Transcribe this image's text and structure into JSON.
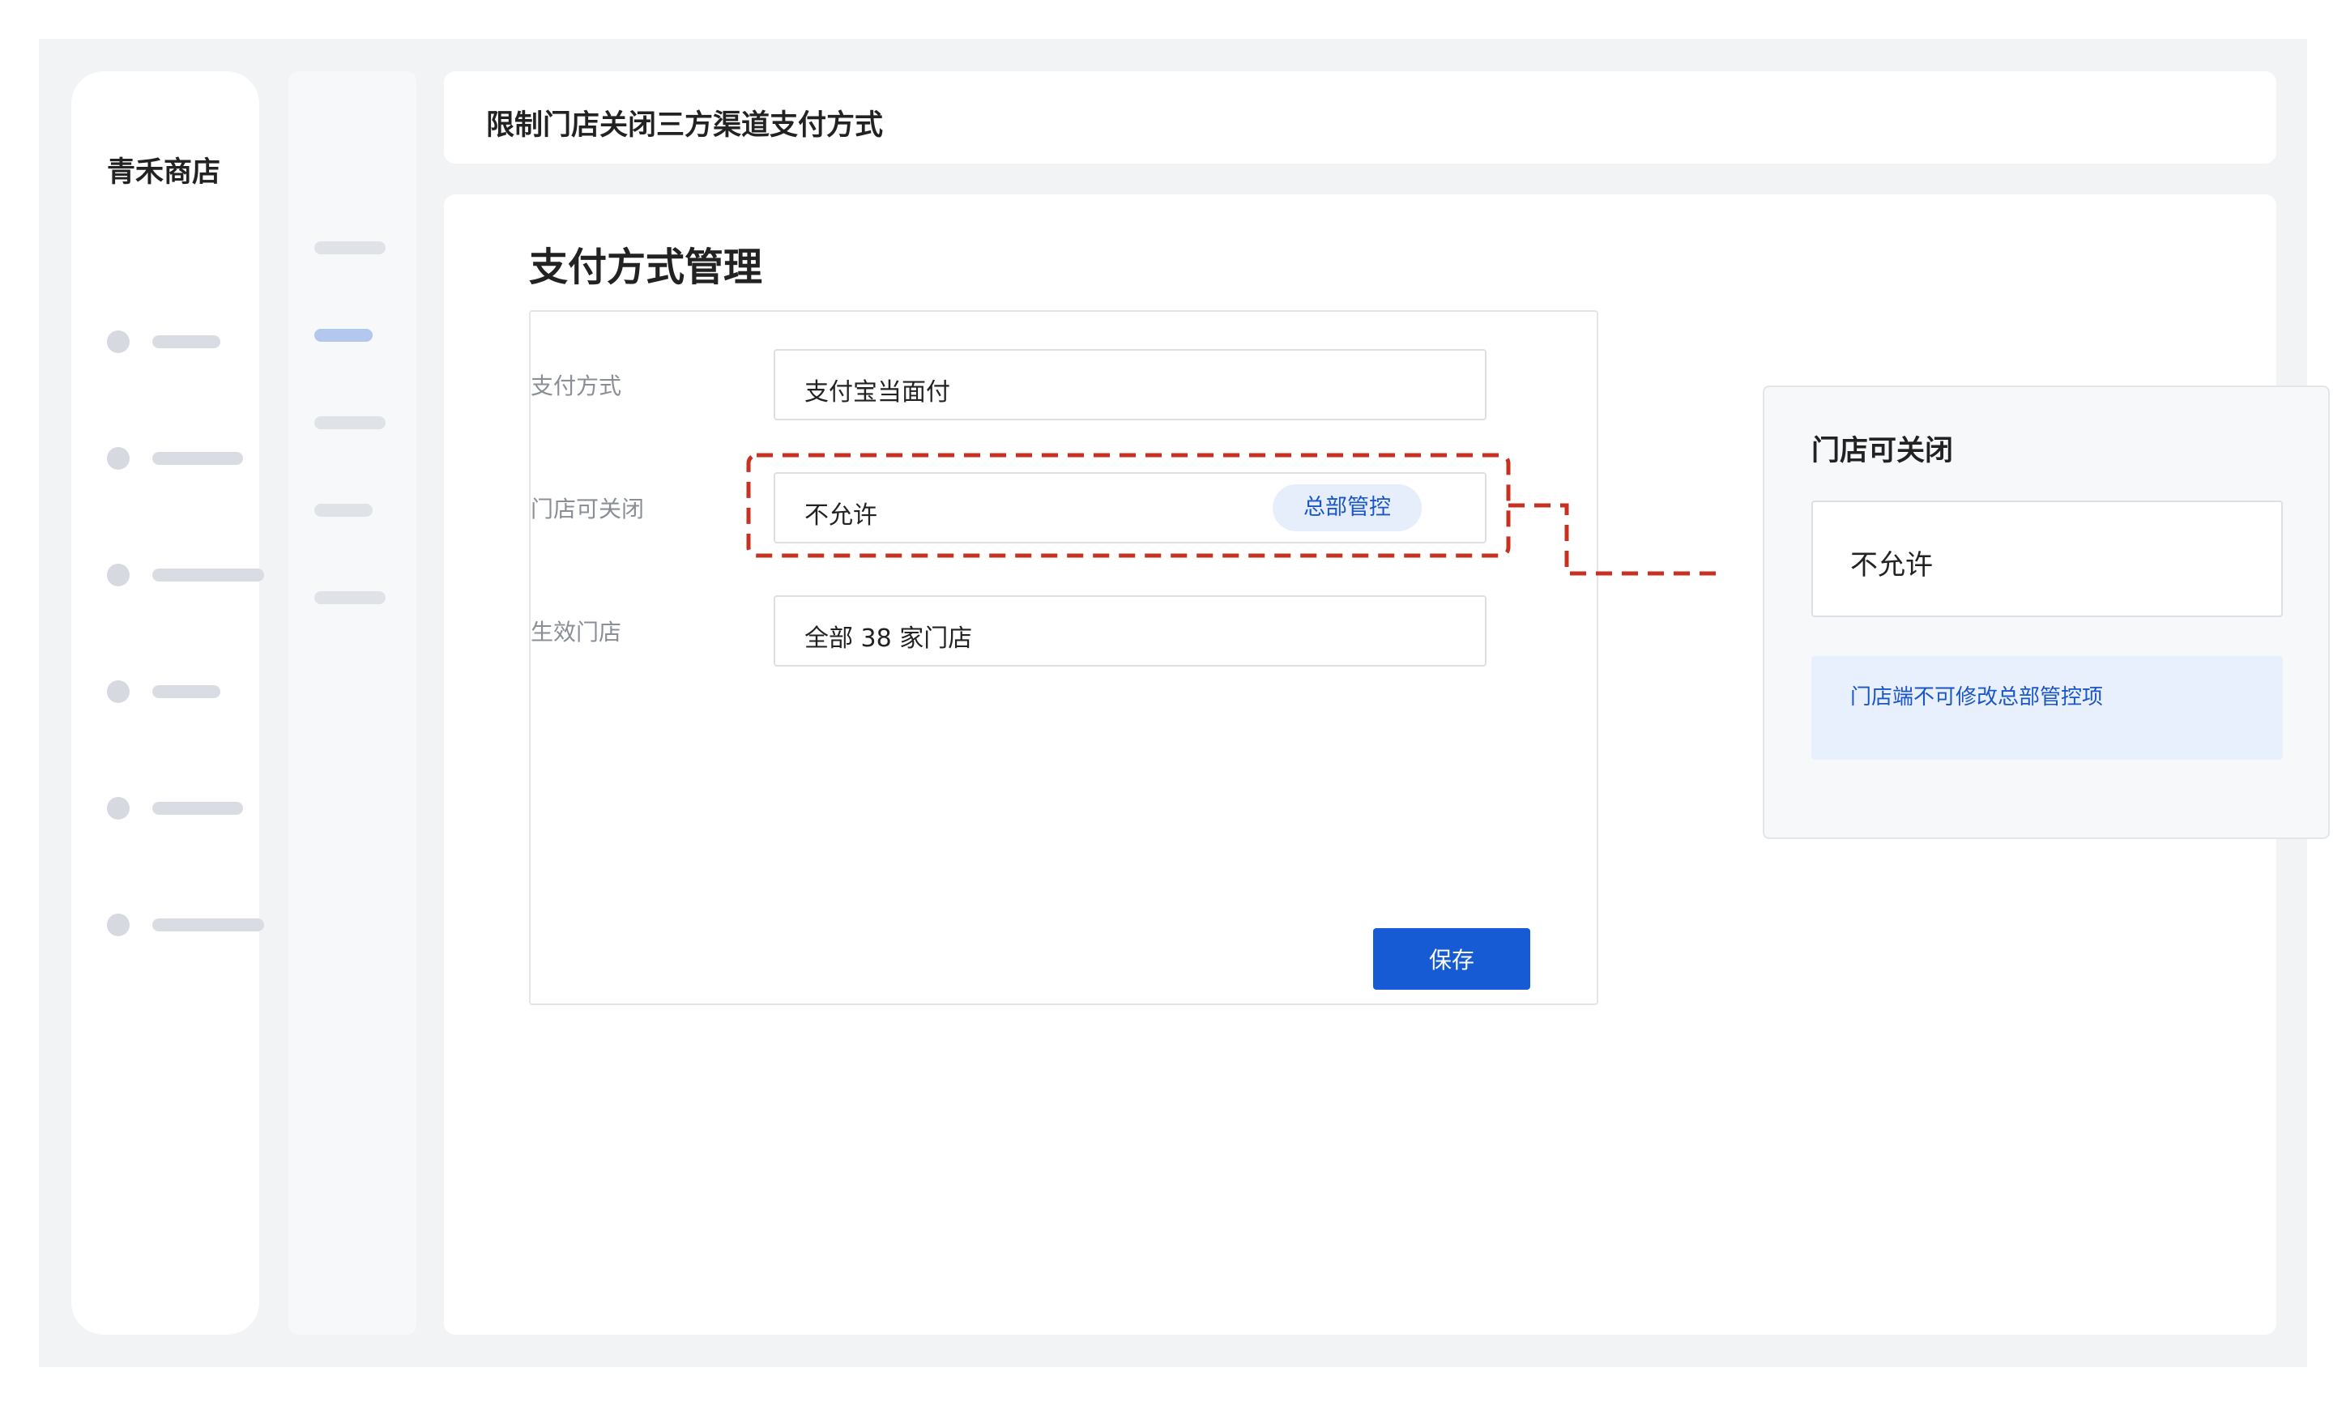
{
  "sidebar": {
    "brand": "青禾商店",
    "nav_items": [
      {
        "icon": "placeholder-dot-icon"
      },
      {
        "icon": "placeholder-dot-icon"
      },
      {
        "icon": "placeholder-dot-icon"
      },
      {
        "icon": "placeholder-dot-icon"
      },
      {
        "icon": "placeholder-dot-icon"
      },
      {
        "icon": "placeholder-dot-icon"
      }
    ]
  },
  "header": {
    "title": "限制门店关闭三方渠道支付方式"
  },
  "main": {
    "page_title": "支付方式管理",
    "form": {
      "fields": [
        {
          "label": "支付方式",
          "value": "支付宝当面付"
        },
        {
          "label": "门店可关闭",
          "value": "不允许",
          "badge": "总部管控"
        },
        {
          "label": "生效门店",
          "value": "全部 38 家门店"
        }
      ],
      "save_label": "保存"
    }
  },
  "callout": {
    "title": "门店可关闭",
    "value": "不允许",
    "note": "门店端不可修改总部管控项"
  },
  "colors": {
    "accent": "#165bd4",
    "highlight": "#c8301f",
    "badge_bg": "#e6eefc",
    "note_bg": "#e8effd"
  }
}
